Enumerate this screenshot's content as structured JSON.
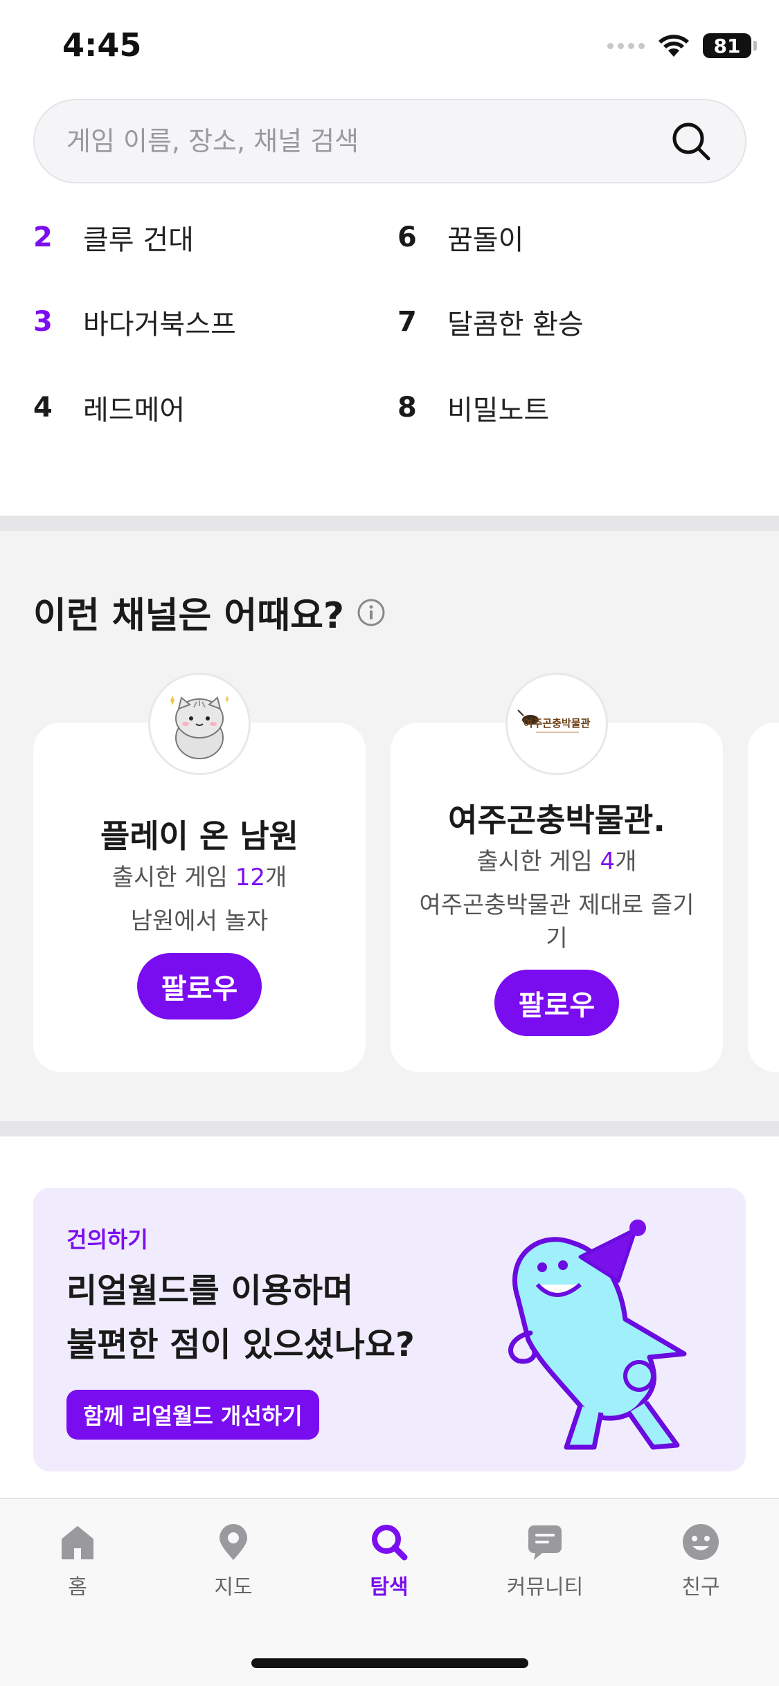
{
  "status_bar": {
    "time": "4:45",
    "battery": "81"
  },
  "search": {
    "placeholder": "게임 이름, 장소, 채널 검색"
  },
  "ranking": [
    {
      "rank": "2",
      "name": "클루 건대",
      "highlight": true
    },
    {
      "rank": "3",
      "name": "바다거북스프",
      "highlight": true
    },
    {
      "rank": "4",
      "name": "레드메어",
      "highlight": false
    },
    {
      "rank": "6",
      "name": "꿈돌이",
      "highlight": false
    },
    {
      "rank": "7",
      "name": "달콤한 환승",
      "highlight": false
    },
    {
      "rank": "8",
      "name": "비밀노트",
      "highlight": false
    }
  ],
  "channels": {
    "title": "이런 채널은 어때요?",
    "cards": [
      {
        "name": "플레이 온 남원",
        "count_prefix": "출시한 게임 ",
        "count": "12",
        "count_suffix": "개",
        "desc": "남원에서 놀자",
        "follow_label": "팔로우"
      },
      {
        "name": "여주곤충박물관.",
        "count_prefix": "출시한 게임 ",
        "count": "4",
        "count_suffix": "개",
        "desc": "여주곤충박물관 제대로 즐기기",
        "follow_label": "팔로우",
        "logo_text": "여주곤충박물관"
      }
    ]
  },
  "feedback": {
    "tag": "건의하기",
    "title_line1": "리얼월드를 이용하며",
    "title_line2": "불편한 점이 있으셨나요?",
    "button_label": "함께 리얼월드 개선하기"
  },
  "tabs": [
    {
      "label": "홈",
      "icon": "home-icon"
    },
    {
      "label": "지도",
      "icon": "map-pin-icon"
    },
    {
      "label": "탐색",
      "icon": "search-icon",
      "active": true
    },
    {
      "label": "커뮤니티",
      "icon": "chat-icon"
    },
    {
      "label": "친구",
      "icon": "smiley-icon"
    }
  ],
  "colors": {
    "accent": "#7b0ef0",
    "banner_bg": "#f1ecfd",
    "section_bg": "#f3f3f4"
  }
}
